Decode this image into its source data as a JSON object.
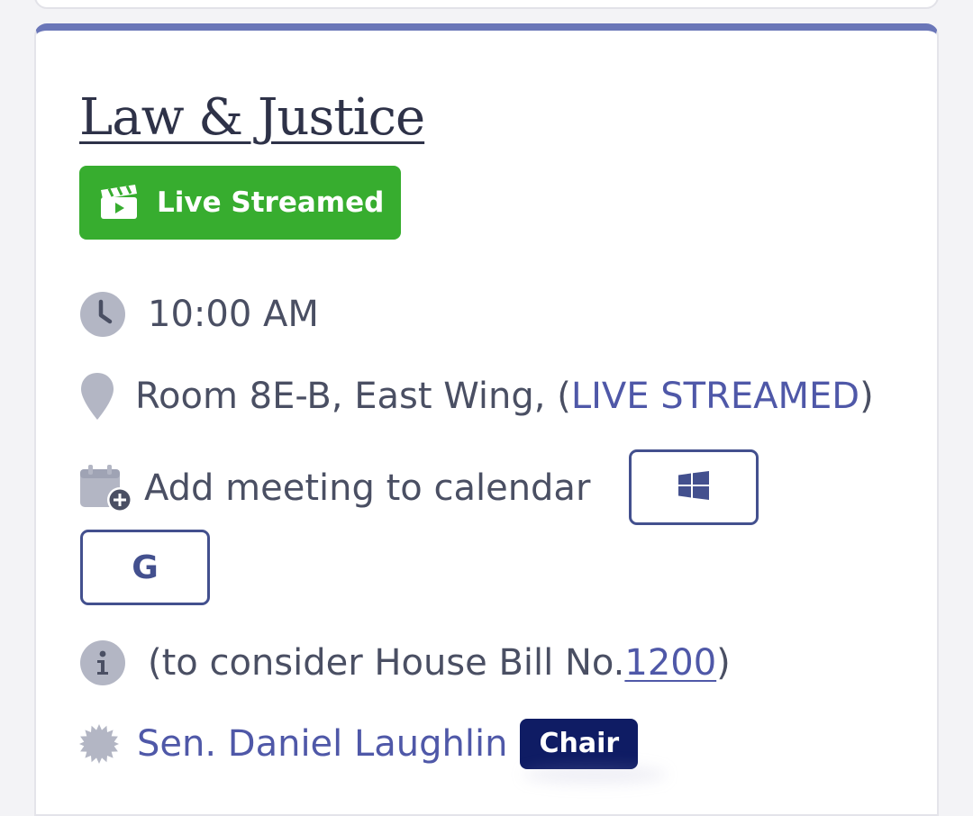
{
  "committee": {
    "title": "Law & Justice",
    "accent_color": "#6a76b8"
  },
  "live_badge": {
    "label": "Live Streamed",
    "icon": "clapperboard-icon",
    "color": "#37ad2f"
  },
  "time": {
    "icon": "clock-icon",
    "value": "10:00 AM"
  },
  "location": {
    "icon": "map-pin-icon",
    "prefix": "Room 8E-B, East Wing, (",
    "link": "LIVE STREAMED",
    "suffix": " )"
  },
  "calendar": {
    "icon": "calendar-plus-icon",
    "label": "Add meeting to calendar",
    "buttons": [
      {
        "icon": "windows-icon"
      },
      {
        "icon": "google-icon",
        "glyph": "G"
      }
    ]
  },
  "info": {
    "icon": "info-icon",
    "prefix": "(to consider House Bill No. ",
    "bill_link": "1200",
    "suffix": ")"
  },
  "member": {
    "icon": "seal-icon",
    "name": "Sen. Daniel Laughlin",
    "role": "Chair"
  }
}
